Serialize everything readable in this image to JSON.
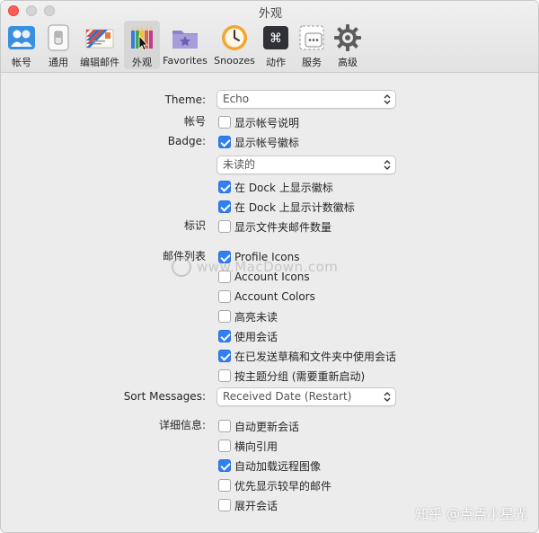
{
  "window": {
    "title": "外观"
  },
  "toolbar": {
    "items": [
      {
        "label": "帐号",
        "icon": "accounts-icon"
      },
      {
        "label": "通用",
        "icon": "general-switch-icon"
      },
      {
        "label": "编辑邮件",
        "icon": "compose-envelope-icon"
      },
      {
        "label": "外观",
        "icon": "appearance-pencils-icon",
        "selected": true
      },
      {
        "label": "Favorites",
        "icon": "favorites-folder-icon"
      },
      {
        "label": "Snoozes",
        "icon": "snooze-clock-icon"
      },
      {
        "label": "动作",
        "icon": "actions-command-icon"
      },
      {
        "label": "服务",
        "icon": "services-icon"
      },
      {
        "label": "高级",
        "icon": "advanced-gear-icon"
      }
    ]
  },
  "form": {
    "theme": {
      "label": "Theme:",
      "value": "Echo"
    },
    "account": {
      "label": "帐号",
      "show_description": {
        "text": "显示帐号说明",
        "checked": false
      }
    },
    "badge": {
      "label": "Badge:",
      "show_badge": {
        "text": "显示帐号徽标",
        "checked": true
      },
      "select_value": "未读的",
      "dock_badge": {
        "text": "在 Dock 上显示徽标",
        "checked": true
      },
      "dock_count": {
        "text": "在 Dock 上显示计数徽标",
        "checked": true
      }
    },
    "marker": {
      "label": "标识",
      "folder_count": {
        "text": "显示文件夹邮件数量",
        "checked": false
      }
    },
    "mail_list": {
      "label": "邮件列表",
      "options": [
        {
          "text": "Profile Icons",
          "checked": true
        },
        {
          "text": "Account Icons",
          "checked": false
        },
        {
          "text": "Account Colors",
          "checked": false
        },
        {
          "text": "高亮未读",
          "checked": false
        },
        {
          "text": "使用会话",
          "checked": true
        },
        {
          "text": "在已发送草稿和文件夹中使用会话",
          "checked": true
        },
        {
          "text": "按主题分组 (需要重新启动)",
          "checked": false
        }
      ]
    },
    "sort": {
      "label": "Sort Messages:",
      "value": "Received Date (Restart)"
    },
    "details": {
      "label": "详细信息:",
      "options": [
        {
          "text": "自动更新会话",
          "checked": false
        },
        {
          "text": "横向引用",
          "checked": false
        },
        {
          "text": "自动加载远程图像",
          "checked": true
        },
        {
          "text": "优先显示较早的邮件",
          "checked": false
        },
        {
          "text": "展开会话",
          "checked": false
        }
      ]
    }
  },
  "overlay": {
    "watermark": "www.MacDown.com",
    "credit": "知乎 @点点小星光"
  },
  "colors": {
    "accent": "#2f7ff5",
    "close": "#fd5f57"
  }
}
